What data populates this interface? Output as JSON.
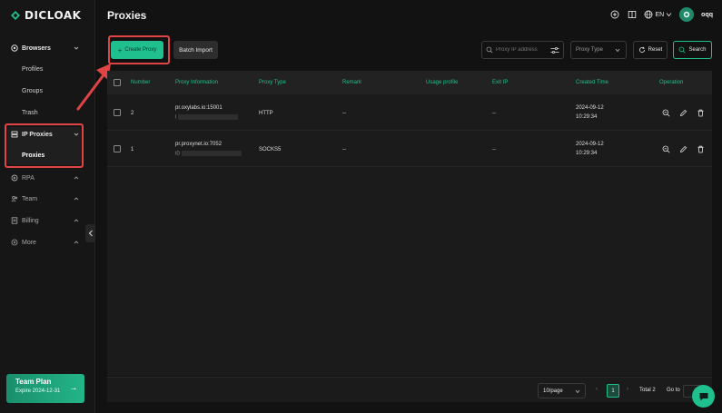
{
  "brand": {
    "name": "DICLOAK",
    "accent": "#1fc08d",
    "highlight": "#e04444"
  },
  "sidebar": {
    "groups": [
      {
        "label": "Browsers",
        "icon": "browser-icon",
        "items": [
          "Profiles",
          "Groups",
          "Trash"
        ]
      },
      {
        "label": "IP Proxies",
        "icon": "proxy-icon",
        "items": [
          "Proxies"
        ]
      },
      {
        "label": "RPA",
        "icon": "rpa-icon"
      },
      {
        "label": "Team",
        "icon": "team-icon"
      },
      {
        "label": "Billing",
        "icon": "billing-icon"
      },
      {
        "label": "More",
        "icon": "more-icon"
      }
    ],
    "plan": {
      "title": "Team Plan",
      "expire": "Expire 2024-12-31"
    }
  },
  "header": {
    "title": "Proxies",
    "language": "EN",
    "username": "oqq"
  },
  "toolbar": {
    "create_label": "Create Proxy",
    "batch_label": "Batch Import",
    "search_placeholder": "Proxy IP address",
    "type_placeholder": "Proxy Type",
    "reset_label": "Reset",
    "search_label": "Search"
  },
  "table": {
    "columns": [
      "Number",
      "Proxy Information",
      "Proxy Type",
      "Remark",
      "Usage profile",
      "Exit IP",
      "Created Time",
      "Operation"
    ],
    "rows": [
      {
        "number": "2",
        "host": "pr.oxylabs.io:15001",
        "id_prefix": "I",
        "type": "HTTP",
        "remark": "--",
        "usage": "",
        "exit_ip": "--",
        "date": "2024-09-12",
        "time": "10:29:34"
      },
      {
        "number": "1",
        "host": "pr.proxynet.io:7052",
        "id_prefix": "ID",
        "type": "SOCKS5",
        "remark": "--",
        "usage": "",
        "exit_ip": "--",
        "date": "2024-09-12",
        "time": "10:29:34"
      }
    ]
  },
  "pagination": {
    "page_size": "10/page",
    "current": "1",
    "total": "Total 2",
    "goto": "Go to"
  }
}
